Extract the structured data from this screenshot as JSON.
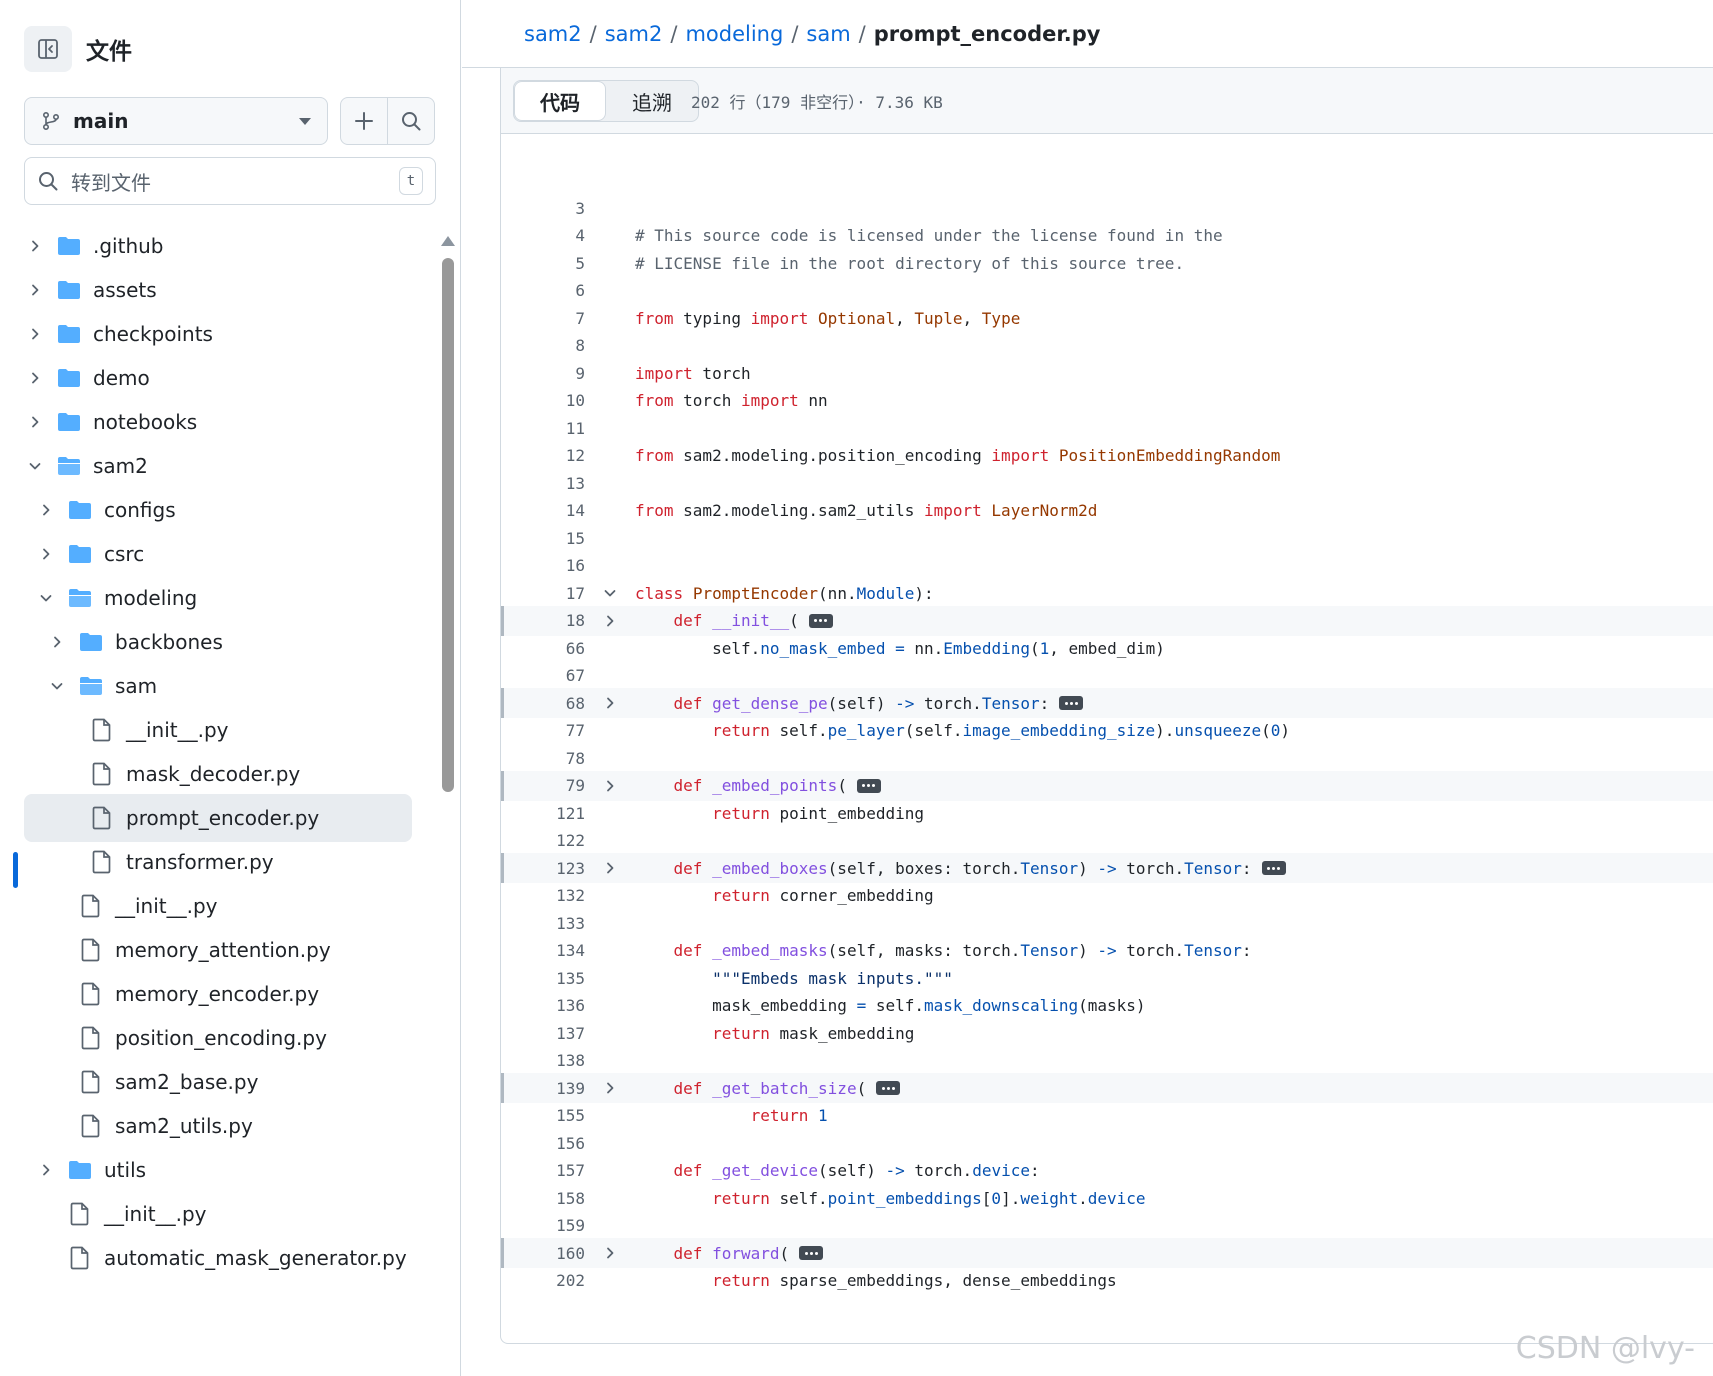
{
  "sidebar": {
    "title": "文件",
    "branch": "main",
    "goto_placeholder": "转到文件",
    "goto_shortcut": "t",
    "tree": [
      {
        "name": ".github",
        "type": "folder",
        "expanded": false,
        "depth": 0
      },
      {
        "name": "assets",
        "type": "folder",
        "expanded": false,
        "depth": 0
      },
      {
        "name": "checkpoints",
        "type": "folder",
        "expanded": false,
        "depth": 0
      },
      {
        "name": "demo",
        "type": "folder",
        "expanded": false,
        "depth": 0
      },
      {
        "name": "notebooks",
        "type": "folder",
        "expanded": false,
        "depth": 0
      },
      {
        "name": "sam2",
        "type": "folder",
        "expanded": true,
        "depth": 0
      },
      {
        "name": "configs",
        "type": "folder",
        "expanded": false,
        "depth": 1
      },
      {
        "name": "csrc",
        "type": "folder",
        "expanded": false,
        "depth": 1
      },
      {
        "name": "modeling",
        "type": "folder",
        "expanded": true,
        "depth": 1
      },
      {
        "name": "backbones",
        "type": "folder",
        "expanded": false,
        "depth": 2
      },
      {
        "name": "sam",
        "type": "folder",
        "expanded": true,
        "depth": 2
      },
      {
        "name": "__init__.py",
        "type": "file",
        "depth": 3
      },
      {
        "name": "mask_decoder.py",
        "type": "file",
        "depth": 3
      },
      {
        "name": "prompt_encoder.py",
        "type": "file",
        "depth": 3,
        "selected": true
      },
      {
        "name": "transformer.py",
        "type": "file",
        "depth": 3
      },
      {
        "name": "__init__.py",
        "type": "file",
        "depth": 2
      },
      {
        "name": "memory_attention.py",
        "type": "file",
        "depth": 2
      },
      {
        "name": "memory_encoder.py",
        "type": "file",
        "depth": 2
      },
      {
        "name": "position_encoding.py",
        "type": "file",
        "depth": 2
      },
      {
        "name": "sam2_base.py",
        "type": "file",
        "depth": 2
      },
      {
        "name": "sam2_utils.py",
        "type": "file",
        "depth": 2
      },
      {
        "name": "utils",
        "type": "folder",
        "expanded": false,
        "depth": 1
      },
      {
        "name": "__init__.py",
        "type": "file",
        "depth": 1
      },
      {
        "name": "automatic_mask_generator.py",
        "type": "file",
        "depth": 1
      }
    ]
  },
  "breadcrumb": {
    "parts": [
      "sam2",
      "sam2",
      "modeling",
      "sam"
    ],
    "current": "prompt_encoder.py"
  },
  "toolbar": {
    "code_tab": "代码",
    "blame_tab": "追溯",
    "meta": "202 行（179 非空行）· 7.36 KB"
  },
  "code_lines": [
    {
      "n": "3",
      "tokens": []
    },
    {
      "n": "4",
      "tokens": [
        [
          "com",
          "# This source code is licensed under the license found in the"
        ]
      ]
    },
    {
      "n": "5",
      "tokens": [
        [
          "com",
          "# LICENSE file in the root directory of this source tree."
        ]
      ]
    },
    {
      "n": "6",
      "tokens": []
    },
    {
      "n": "7",
      "tokens": [
        [
          "kw",
          "from"
        ],
        [
          "",
          " typing "
        ],
        [
          "kw",
          "import"
        ],
        [
          "",
          " "
        ],
        [
          "cls",
          "Optional"
        ],
        [
          "",
          ", "
        ],
        [
          "cls",
          "Tuple"
        ],
        [
          "",
          ", "
        ],
        [
          "cls",
          "Type"
        ]
      ]
    },
    {
      "n": "8",
      "tokens": []
    },
    {
      "n": "9",
      "tokens": [
        [
          "kw",
          "import"
        ],
        [
          "",
          " torch"
        ]
      ]
    },
    {
      "n": "10",
      "tokens": [
        [
          "kw",
          "from"
        ],
        [
          "",
          " torch "
        ],
        [
          "kw",
          "import"
        ],
        [
          "",
          " nn"
        ]
      ]
    },
    {
      "n": "11",
      "tokens": []
    },
    {
      "n": "12",
      "tokens": [
        [
          "kw",
          "from"
        ],
        [
          "",
          " sam2.modeling.position_encoding "
        ],
        [
          "kw",
          "import"
        ],
        [
          "",
          " "
        ],
        [
          "cls",
          "PositionEmbeddingRandom"
        ]
      ]
    },
    {
      "n": "13",
      "tokens": []
    },
    {
      "n": "14",
      "tokens": [
        [
          "kw",
          "from"
        ],
        [
          "",
          " sam2.modeling.sam2_utils "
        ],
        [
          "kw",
          "import"
        ],
        [
          "",
          " "
        ],
        [
          "cls",
          "LayerNorm2d"
        ]
      ]
    },
    {
      "n": "15",
      "tokens": []
    },
    {
      "n": "16",
      "tokens": []
    },
    {
      "n": "17",
      "fold": "open",
      "tokens": [
        [
          "kw",
          "class"
        ],
        [
          "",
          " "
        ],
        [
          "cls",
          "PromptEncoder"
        ],
        [
          "",
          "(nn."
        ],
        [
          "attr",
          "Module"
        ],
        [
          "",
          "):"
        ]
      ]
    },
    {
      "n": "18",
      "fold": "closed",
      "ellipsis": true,
      "tokens": [
        [
          "",
          "    "
        ],
        [
          "kw",
          "def"
        ],
        [
          "",
          " "
        ],
        [
          "fn",
          "__init__"
        ],
        [
          "",
          "("
        ]
      ]
    },
    {
      "n": "66",
      "tokens": [
        [
          "",
          "        self."
        ],
        [
          "attr",
          "no_mask_embed"
        ],
        [
          "",
          " "
        ],
        [
          "attr",
          "="
        ],
        [
          "",
          " nn."
        ],
        [
          "attr",
          "Embedding"
        ],
        [
          "",
          "("
        ],
        [
          "num",
          "1"
        ],
        [
          "",
          ", embed_dim)"
        ]
      ]
    },
    {
      "n": "67",
      "tokens": []
    },
    {
      "n": "68",
      "fold": "closed",
      "ellipsis": true,
      "tokens": [
        [
          "",
          "    "
        ],
        [
          "kw",
          "def"
        ],
        [
          "",
          " "
        ],
        [
          "fn",
          "get_dense_pe"
        ],
        [
          "",
          "(self) "
        ],
        [
          "attr",
          "->"
        ],
        [
          "",
          " torch."
        ],
        [
          "attr",
          "Tensor"
        ],
        [
          "",
          ":"
        ]
      ]
    },
    {
      "n": "77",
      "tokens": [
        [
          "",
          "        "
        ],
        [
          "kw",
          "return"
        ],
        [
          "",
          " self."
        ],
        [
          "attr",
          "pe_layer"
        ],
        [
          "",
          "(self."
        ],
        [
          "attr",
          "image_embedding_size"
        ],
        [
          "",
          ")."
        ],
        [
          "attr",
          "unsqueeze"
        ],
        [
          "",
          "("
        ],
        [
          "num",
          "0"
        ],
        [
          "",
          ")"
        ]
      ]
    },
    {
      "n": "78",
      "tokens": []
    },
    {
      "n": "79",
      "fold": "closed",
      "ellipsis": true,
      "tokens": [
        [
          "",
          "    "
        ],
        [
          "kw",
          "def"
        ],
        [
          "",
          " "
        ],
        [
          "fn",
          "_embed_points"
        ],
        [
          "",
          "("
        ]
      ]
    },
    {
      "n": "121",
      "tokens": [
        [
          "",
          "        "
        ],
        [
          "kw",
          "return"
        ],
        [
          "",
          " point_embedding"
        ]
      ]
    },
    {
      "n": "122",
      "tokens": []
    },
    {
      "n": "123",
      "fold": "closed",
      "ellipsis": true,
      "tokens": [
        [
          "",
          "    "
        ],
        [
          "kw",
          "def"
        ],
        [
          "",
          " "
        ],
        [
          "fn",
          "_embed_boxes"
        ],
        [
          "",
          "(self, boxes: torch."
        ],
        [
          "attr",
          "Tensor"
        ],
        [
          "",
          ") "
        ],
        [
          "attr",
          "->"
        ],
        [
          "",
          " torch."
        ],
        [
          "attr",
          "Tensor"
        ],
        [
          "",
          ":"
        ]
      ]
    },
    {
      "n": "132",
      "tokens": [
        [
          "",
          "        "
        ],
        [
          "kw",
          "return"
        ],
        [
          "",
          " corner_embedding"
        ]
      ]
    },
    {
      "n": "133",
      "tokens": []
    },
    {
      "n": "134",
      "tokens": [
        [
          "",
          "    "
        ],
        [
          "kw",
          "def"
        ],
        [
          "",
          " "
        ],
        [
          "fn",
          "_embed_masks"
        ],
        [
          "",
          "(self, masks: torch."
        ],
        [
          "attr",
          "Tensor"
        ],
        [
          "",
          ") "
        ],
        [
          "attr",
          "->"
        ],
        [
          "",
          " torch."
        ],
        [
          "attr",
          "Tensor"
        ],
        [
          "",
          ":"
        ]
      ]
    },
    {
      "n": "135",
      "tokens": [
        [
          "",
          "        "
        ],
        [
          "str",
          "\"\"\"Embeds mask inputs.\"\"\""
        ]
      ]
    },
    {
      "n": "136",
      "tokens": [
        [
          "",
          "        mask_embedding "
        ],
        [
          "attr",
          "="
        ],
        [
          "",
          " self."
        ],
        [
          "attr",
          "mask_downscaling"
        ],
        [
          "",
          "(masks)"
        ]
      ]
    },
    {
      "n": "137",
      "tokens": [
        [
          "",
          "        "
        ],
        [
          "kw",
          "return"
        ],
        [
          "",
          " mask_embedding"
        ]
      ]
    },
    {
      "n": "138",
      "tokens": []
    },
    {
      "n": "139",
      "fold": "closed",
      "ellipsis": true,
      "tokens": [
        [
          "",
          "    "
        ],
        [
          "kw",
          "def"
        ],
        [
          "",
          " "
        ],
        [
          "fn",
          "_get_batch_size"
        ],
        [
          "",
          "("
        ]
      ]
    },
    {
      "n": "155",
      "tokens": [
        [
          "",
          "            "
        ],
        [
          "kw",
          "return"
        ],
        [
          "",
          " "
        ],
        [
          "num",
          "1"
        ]
      ]
    },
    {
      "n": "156",
      "tokens": []
    },
    {
      "n": "157",
      "tokens": [
        [
          "",
          "    "
        ],
        [
          "kw",
          "def"
        ],
        [
          "",
          " "
        ],
        [
          "fn",
          "_get_device"
        ],
        [
          "",
          "(self) "
        ],
        [
          "attr",
          "->"
        ],
        [
          "",
          " torch."
        ],
        [
          "attr",
          "device"
        ],
        [
          "",
          ":"
        ]
      ]
    },
    {
      "n": "158",
      "tokens": [
        [
          "",
          "        "
        ],
        [
          "kw",
          "return"
        ],
        [
          "",
          " self."
        ],
        [
          "attr",
          "point_embeddings"
        ],
        [
          "",
          "["
        ],
        [
          "num",
          "0"
        ],
        [
          "",
          "]."
        ],
        [
          "attr",
          "weight"
        ],
        [
          "",
          "."
        ],
        [
          "attr",
          "device"
        ]
      ]
    },
    {
      "n": "159",
      "tokens": []
    },
    {
      "n": "160",
      "fold": "closed",
      "ellipsis": true,
      "tokens": [
        [
          "",
          "    "
        ],
        [
          "kw",
          "def"
        ],
        [
          "",
          " "
        ],
        [
          "fn",
          "forward"
        ],
        [
          "",
          "("
        ]
      ]
    },
    {
      "n": "202",
      "tokens": [
        [
          "",
          "        "
        ],
        [
          "kw",
          "return"
        ],
        [
          "",
          " sparse_embeddings, dense_embeddings"
        ]
      ]
    }
  ],
  "watermark": "CSDN @lvy-",
  "colors": {
    "accent": "#0969da",
    "folder": "#54aeff",
    "keyword": "#cf222e",
    "class": "#953800",
    "function": "#8250df",
    "attribute": "#0550ae",
    "comment": "#59636e",
    "string": "#0a3069"
  },
  "icons": {
    "sidebar_toggle": "sidebar-collapse-icon",
    "branch": "git-branch-icon",
    "add": "plus-icon",
    "search": "search-icon",
    "folder": "folder-icon",
    "folder_open": "folder-open-icon",
    "file": "file-icon",
    "chevron_right": "chevron-right-icon",
    "chevron_down": "chevron-down-icon",
    "ellipsis": "ellipsis-icon"
  }
}
